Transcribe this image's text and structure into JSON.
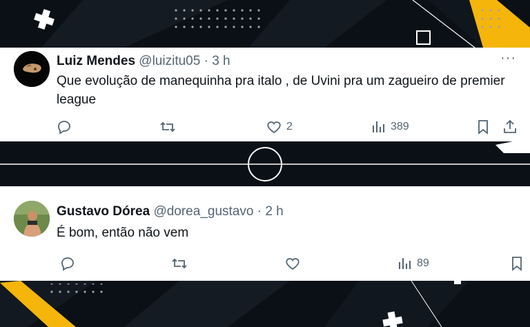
{
  "tweets": [
    {
      "name": "Luiz Mendes",
      "handle": "@luizitu05",
      "separator": "·",
      "time": "3 h",
      "text": "Que evolução de manequinha pra italo , de Uvini pra um zagueiro de premier league",
      "more": "···",
      "likes": "2",
      "views": "389"
    },
    {
      "name": "Gustavo Dórea",
      "handle": "@dorea_gustavo",
      "separator": "·",
      "time": "2 h",
      "text": "É bom, então não vem",
      "views": "89"
    }
  ],
  "colors": {
    "accent": "#f5b50a",
    "text": "#0f1419",
    "muted": "#536471"
  }
}
